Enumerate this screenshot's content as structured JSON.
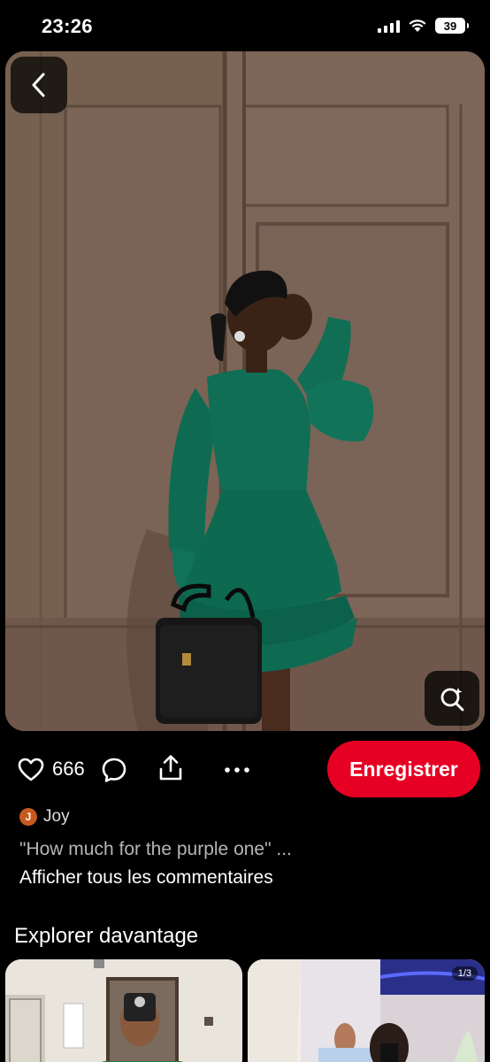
{
  "status_bar": {
    "time": "23:26",
    "battery": "39"
  },
  "pin": {
    "image_alt": "Woman in green ruffled dress holding black handbag against a brown door",
    "back_icon": "chevron-left-icon",
    "lens_icon": "visual-search-icon"
  },
  "actions": {
    "like_count": "666",
    "save_label": "Enregistrer"
  },
  "comment": {
    "author_initial": "J",
    "author_name": "Joy",
    "text": "\"How much for the purple one\" ...",
    "see_all": "Afficher tous les commentaires"
  },
  "explore": {
    "title": "Explorer davantage",
    "items": [
      {
        "kind": "mirror-selfie"
      },
      {
        "kind": "fashion-shop",
        "page_indicator": "1/3"
      }
    ]
  },
  "colors": {
    "accent": "#e60023",
    "background": "#000000",
    "avatar": "#c65a1e"
  }
}
